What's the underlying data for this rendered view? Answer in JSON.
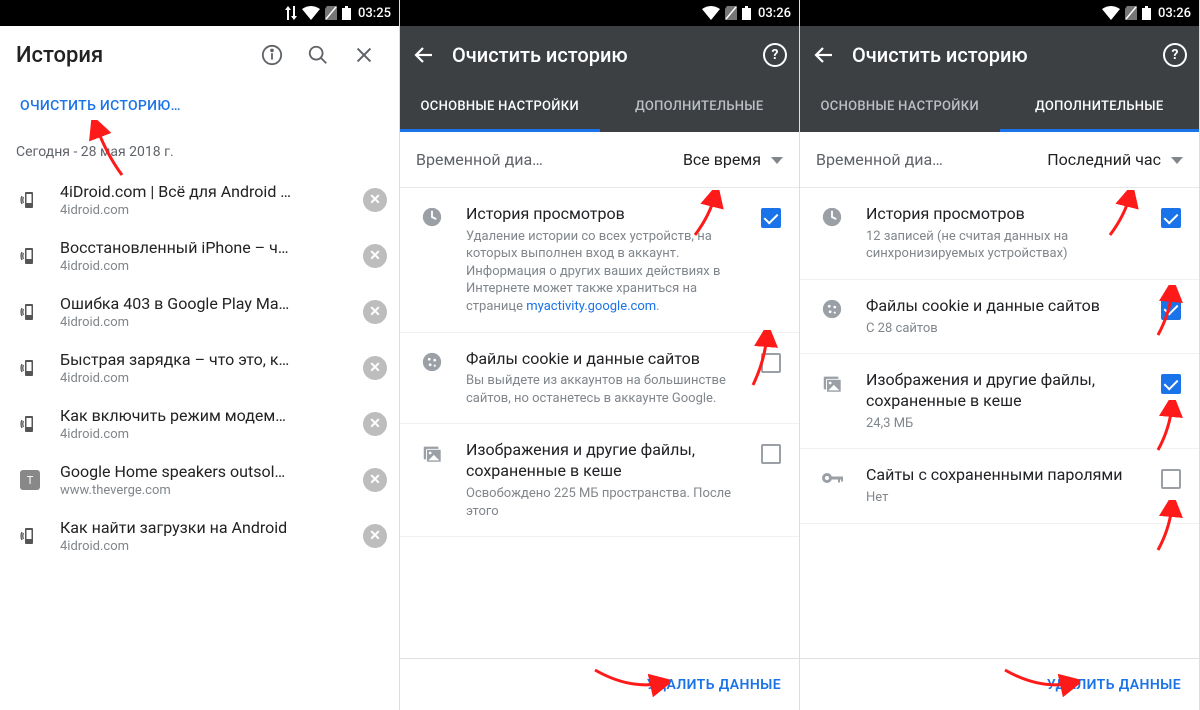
{
  "statusbar": {
    "time1": "03:25",
    "time2": "03:26",
    "time3": "03:26"
  },
  "screen1": {
    "title": "История",
    "clear_label": "ОЧИСТИТЬ ИСТОРИЮ…",
    "date": "Сегодня - 28 мая 2018 г.",
    "items": [
      {
        "title": "4iDroid.com | Всё для Android …",
        "domain": "4idroid.com",
        "fav": "phone"
      },
      {
        "title": "Восстановленный iPhone – ч…",
        "domain": "4idroid.com",
        "fav": "phone"
      },
      {
        "title": "Ошибка 403 в Google Play Ma…",
        "domain": "4idroid.com",
        "fav": "phone"
      },
      {
        "title": "Быстрая зарядка – что это, к…",
        "domain": "4idroid.com",
        "fav": "phone"
      },
      {
        "title": "Как включить режим модем…",
        "domain": "4idroid.com",
        "fav": "phone"
      },
      {
        "title": "Google Home speakers outsol…",
        "domain": "www.theverge.com",
        "fav": "t"
      },
      {
        "title": "Как найти загрузки на Android",
        "domain": "4idroid.com",
        "fav": "phone"
      }
    ]
  },
  "screen2": {
    "header": "Очистить историю",
    "tab_basic": "ОСНОВНЫЕ НАСТРОЙКИ",
    "tab_adv": "ДОПОЛНИТЕЛЬНЫЕ",
    "active_tab": "basic",
    "range_label": "Временной диа…",
    "range_value": "Все время",
    "options": [
      {
        "icon": "clock",
        "title": "История просмотров",
        "sub": "Удаление истории со всех устройств, на которых выполнен вход в аккаунт. Информация о других ваших действиях в Интернете может также храниться на странице ",
        "link": "myactivity.google.com",
        "sub_end": ".",
        "checked": true
      },
      {
        "icon": "cookie",
        "title": "Файлы cookie и данные сайтов",
        "sub": "Вы выйдете из аккаунтов на большинстве сайтов, но останетесь в аккаунте Google.",
        "checked": false
      },
      {
        "icon": "image",
        "title": "Изображения и другие файлы, сохраненные в кеше",
        "sub": "Освобождено 225 МБ пространства. После этого",
        "checked": false
      }
    ],
    "delete_btn": "УДАЛИТЬ ДАННЫЕ"
  },
  "screen3": {
    "header": "Очистить историю",
    "tab_basic": "ОСНОВНЫЕ НАСТРОЙКИ",
    "tab_adv": "ДОПОЛНИТЕЛЬНЫЕ",
    "active_tab": "adv",
    "range_label": "Временной диа…",
    "range_value": "Последний час",
    "options": [
      {
        "icon": "clock",
        "title": "История просмотров",
        "sub": "12 записей (не считая данных на синхронизируемых устройствах)",
        "checked": true
      },
      {
        "icon": "cookie",
        "title": "Файлы cookie и данные сайтов",
        "sub": "С 28 сайтов",
        "checked": true
      },
      {
        "icon": "image",
        "title": "Изображения и другие файлы, сохраненные в кеше",
        "sub": "24,3 МБ",
        "checked": true
      },
      {
        "icon": "key",
        "title": "Сайты с сохраненными паролями",
        "sub": "Нет",
        "checked": false
      }
    ],
    "delete_btn": "УДАЛИТЬ ДАННЫЕ"
  }
}
